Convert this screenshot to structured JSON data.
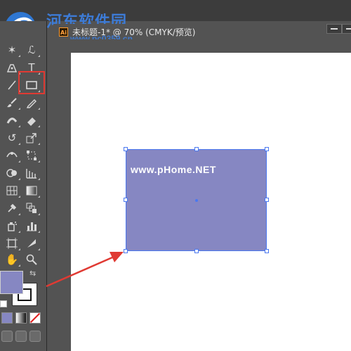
{
  "watermark": {
    "title": "河东软件园",
    "url": "www.pc0359.cn"
  },
  "document": {
    "ai_badge": "Ai",
    "tab_title": "未标题-1* @ 70% (CMYK/预览)"
  },
  "rectangle": {
    "fill_color": "#8687c2",
    "selection_color": "#4a78f0",
    "text": "www.pHome.NET"
  },
  "toolbox": {
    "tools": [
      "magic-wand-tool",
      "lasso-tool",
      "pen-tool",
      "type-tool",
      "line-segment-tool",
      "rectangle-tool",
      "paintbrush-tool",
      "pencil-tool",
      "blob-brush-tool",
      "eraser-tool",
      "rotate-tool",
      "scale-tool",
      "width-tool",
      "free-transform-tool",
      "shape-builder-tool",
      "perspective-grid-tool",
      "mesh-tool",
      "gradient-tool",
      "eyedropper-tool",
      "blend-tool",
      "symbol-sprayer-tool",
      "column-graph-tool",
      "artboard-tool",
      "slice-tool",
      "hand-tool",
      "zoom-tool"
    ],
    "highlighted_tool": "rectangle-tool",
    "fill_color": "#8687c2",
    "stroke_color": "#ffffff"
  },
  "annotations": {
    "highlight_color": "#e03a33"
  }
}
